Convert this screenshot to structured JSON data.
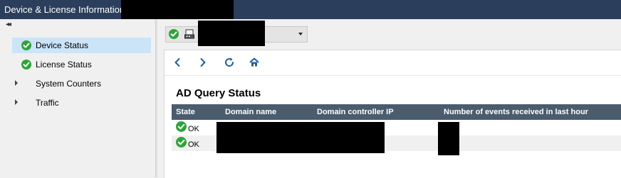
{
  "window": {
    "title": "Device & License Information -"
  },
  "sidebar": {
    "collapse_glyph": "◂◂",
    "items": [
      {
        "label": "Device Status",
        "selected": true,
        "icon": "check-circle-icon"
      },
      {
        "label": "License Status",
        "selected": false,
        "icon": "check-circle-icon"
      },
      {
        "label": "System Counters",
        "selected": false,
        "icon": "expand-caret-icon"
      },
      {
        "label": "Traffic",
        "selected": false,
        "icon": "expand-caret-icon"
      }
    ]
  },
  "device_selector": {
    "status_icon": "check-circle-icon",
    "device_icon": "network-device-icon",
    "dropdown_icon": "chevron-down-icon"
  },
  "toolbar": {
    "back_icon": "back-icon",
    "forward_icon": "forward-icon",
    "refresh_icon": "refresh-icon",
    "home_icon": "home-icon"
  },
  "ad_query": {
    "title": "AD Query Status",
    "columns": [
      "State",
      "Domain name",
      "Domain controller IP",
      "Number of events received in last hour"
    ],
    "rows": [
      {
        "state": "OK"
      },
      {
        "state": "OK"
      }
    ]
  },
  "colors": {
    "titlebar": "#2b3e5c",
    "selected": "#cce4f7",
    "ok_green": "#2ea43a",
    "table_header": "#4a5c6d",
    "icon_blue": "#1f5f9e"
  }
}
